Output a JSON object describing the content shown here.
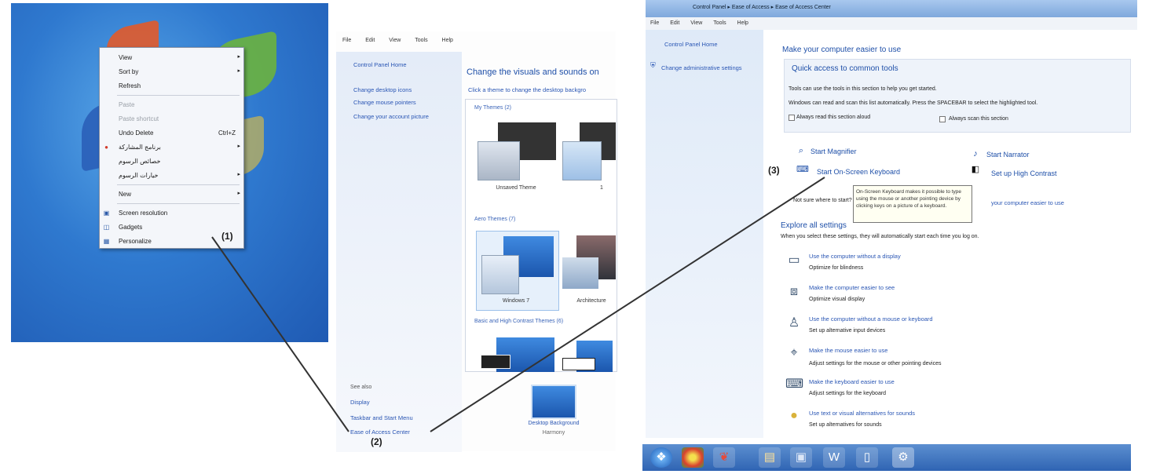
{
  "colors": {
    "desktop": "#2f79cf",
    "link": "#2a56b4",
    "heading": "#1e4fa8",
    "taskbar": "#2f64b3",
    "arrow_line": "#333333"
  },
  "steps": {
    "one": "(1)",
    "two": "(2)",
    "three": "(3)"
  },
  "context_menu": {
    "items": [
      {
        "label": "View",
        "shortcut": "",
        "arrow": "▸",
        "icon": "",
        "disabled": false
      },
      {
        "label": "Sort by",
        "shortcut": "",
        "arrow": "▸",
        "icon": "",
        "disabled": false
      },
      {
        "label": "Refresh",
        "shortcut": "",
        "arrow": "",
        "icon": "",
        "disabled": false
      },
      {
        "label": "Paste",
        "shortcut": "",
        "arrow": "",
        "icon": "",
        "disabled": true
      },
      {
        "label": "Paste shortcut",
        "shortcut": "",
        "arrow": "",
        "icon": "",
        "disabled": true
      },
      {
        "label": "Undo Delete",
        "shortcut": "Ctrl+Z",
        "arrow": "",
        "icon": "",
        "disabled": false
      },
      {
        "label": "برنامج المشاركة",
        "shortcut": "",
        "arrow": "▸",
        "icon": "red-dot-icon",
        "disabled": false
      },
      {
        "label": "خصائص الرسوم",
        "shortcut": "",
        "arrow": "",
        "icon": "",
        "disabled": false
      },
      {
        "label": "خيارات الرسوم",
        "shortcut": "",
        "arrow": "▸",
        "icon": "",
        "disabled": false
      },
      {
        "label": "New",
        "shortcut": "",
        "arrow": "▸",
        "icon": "",
        "disabled": false
      },
      {
        "label": "Screen resolution",
        "shortcut": "",
        "arrow": "",
        "icon": "monitor-icon",
        "disabled": false
      },
      {
        "label": "Gadgets",
        "shortcut": "",
        "arrow": "",
        "icon": "gadgets-icon",
        "disabled": false
      },
      {
        "label": "Personalize",
        "shortcut": "",
        "arrow": "",
        "icon": "personalize-icon",
        "disabled": false
      }
    ]
  },
  "personalization": {
    "menu": [
      "File",
      "Edit",
      "View",
      "Tools",
      "Help"
    ],
    "sidebar_links": [
      "Control Panel Home",
      "Change desktop icons",
      "Change mouse pointers",
      "Change your account picture"
    ],
    "see_also": "See also",
    "bottom_links": [
      "Display",
      "Taskbar and Start Menu",
      "Ease of Access Center"
    ],
    "heading": "Change the visuals and sounds on",
    "subheading": "Click a theme to change the desktop backgro",
    "groups": [
      "My Themes (2)",
      "Aero Themes (7)",
      "Basic and High Contrast Themes (6)"
    ],
    "theme_captions": [
      "Unsaved Theme",
      "1",
      "Windows 7",
      "Architecture"
    ],
    "desktop_bg_caption": "Desktop Background",
    "desktop_bg_sub": "Harmony"
  },
  "ease_of_access": {
    "titlebar": "Control Panel ▸ Ease of Access ▸ Ease of Access Center",
    "menu": [
      "File",
      "Edit",
      "View",
      "Tools",
      "Help"
    ],
    "sidebar_links": [
      "Control Panel Home",
      "Change administrative settings"
    ],
    "title": "Make your computer easier to use",
    "quick_heading": "Quick access to common tools",
    "quick_line1": "Tools can use the tools in this section to help you get started.",
    "quick_line2": "Windows can read and scan this list automatically.  Press the SPACEBAR to select the highlighted tool.",
    "always_read": "Always read this section aloud",
    "always_scan": "Always scan this section",
    "tools": [
      "Start Magnifier",
      "Start Narrator",
      "Start On-Screen Keyboard",
      "Set up High Contrast"
    ],
    "tooltip": "On-Screen Keyboard makes it possible to type using the mouse or another pointing device by clicking keys on a picture of a keyboard.",
    "not_sure_prefix": "Not sure where to start?",
    "not_sure_link": "your computer easier to use",
    "explore_heading": "Explore all settings",
    "explore_sub": "When you select these settings, they will automatically start each time you log on.",
    "settings": [
      {
        "title": "Use the computer without a display",
        "desc": "Optimize for blindness"
      },
      {
        "title": "Make the computer easier to see",
        "desc": "Optimize visual display"
      },
      {
        "title": "Use the computer without a mouse or keyboard",
        "desc": "Set up alternative input devices"
      },
      {
        "title": "Make the mouse easier to use",
        "desc": "Adjust settings for the mouse or other pointing devices"
      },
      {
        "title": "Make the keyboard easier to use",
        "desc": "Adjust settings for the keyboard"
      },
      {
        "title": "Use text or visual alternatives for sounds",
        "desc": "Set up alternatives for sounds"
      }
    ]
  },
  "taskbar": {
    "icons": [
      "start-orb-icon",
      "chrome-icon",
      "app-icon",
      "folder-icon",
      "media-icon",
      "word-icon",
      "documents-icon",
      "control-panel-icon"
    ]
  }
}
